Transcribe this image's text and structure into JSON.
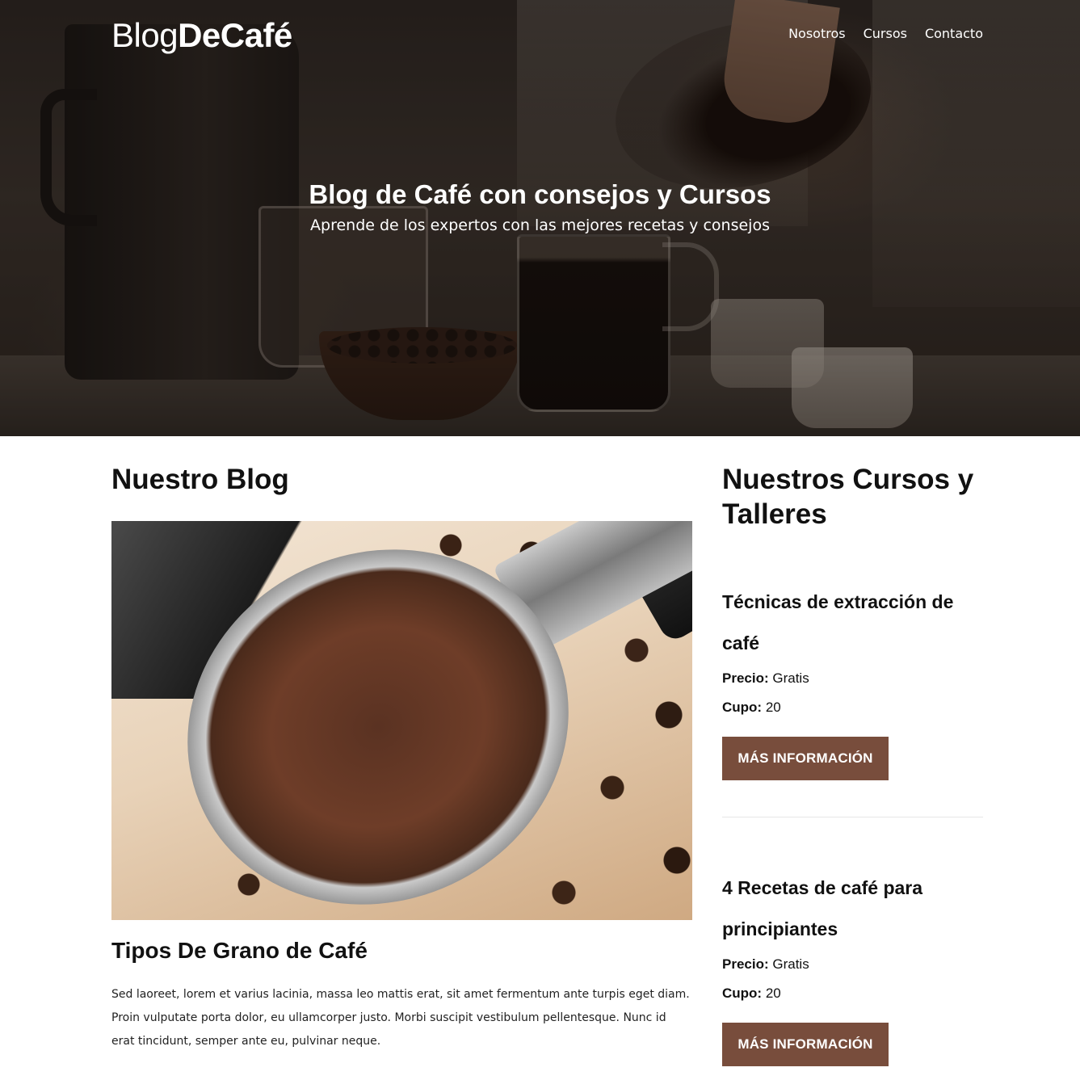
{
  "header": {
    "logo_light": "Blog",
    "logo_bold": "DeCafé",
    "nav": [
      "Nosotros",
      "Cursos",
      "Contacto"
    ]
  },
  "hero": {
    "title": "Blog de Café con consejos y Cursos",
    "subtitle": "Aprende de los expertos con las mejores recetas y consejos"
  },
  "blog": {
    "section_title": "Nuestro Blog",
    "post": {
      "title": "Tipos De Grano de Café",
      "text": "Sed laoreet, lorem et varius lacinia, massa leo mattis erat, sit amet fermentum ante turpis eget diam. Proin vulputate porta dolor, eu ullamcorper justo. Morbi suscipit vestibulum pellentesque. Nunc id erat tincidunt, semper ante eu, pulvinar neque."
    }
  },
  "courses": {
    "section_title": "Nuestros Cursos y Talleres",
    "price_label": "Precio:",
    "spots_label": "Cupo:",
    "button_label": "MÁS INFORMACIÓN",
    "items": [
      {
        "title": "Técnicas de extracción de café",
        "price": "Gratis",
        "spots": "20"
      },
      {
        "title": "4 Recetas de café para principiantes",
        "price": "Gratis",
        "spots": "20"
      }
    ]
  },
  "colors": {
    "accent": "#784d3c",
    "text": "#111111",
    "hero_text": "#ffffff"
  }
}
